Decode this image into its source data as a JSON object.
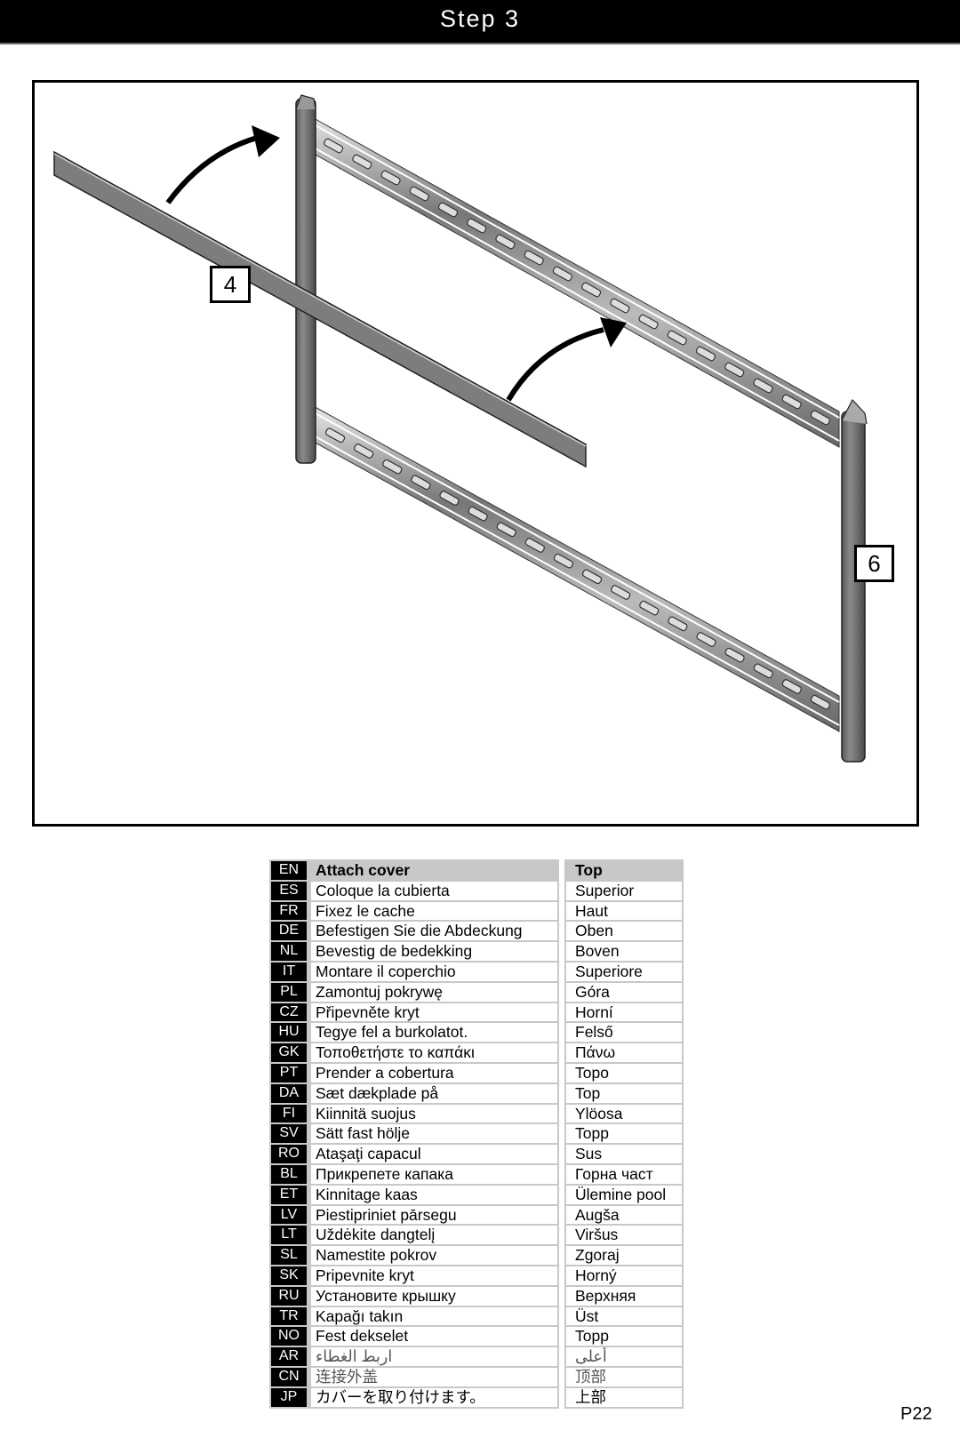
{
  "header": {
    "title": "Step 3"
  },
  "figure": {
    "callouts": [
      {
        "label": "4",
        "part": "cover"
      },
      {
        "label": "6",
        "part": "frame-upright"
      }
    ],
    "arrows": 2
  },
  "table": {
    "rows": [
      {
        "code": "EN",
        "action": "Attach cover",
        "position": "Top"
      },
      {
        "code": "ES",
        "action": "Coloque la cubierta",
        "position": "Superior"
      },
      {
        "code": "FR",
        "action": "Fixez le cache",
        "position": "Haut"
      },
      {
        "code": "DE",
        "action": "Befestigen Sie die Abdeckung",
        "position": "Oben"
      },
      {
        "code": "NL",
        "action": "Bevestig de bedekking",
        "position": "Boven"
      },
      {
        "code": "IT",
        "action": "Montare il coperchio",
        "position": "Superiore"
      },
      {
        "code": "PL",
        "action": "Zamontuj pokrywę",
        "position": "Góra"
      },
      {
        "code": "CZ",
        "action": "Připevněte kryt",
        "position": "Horní"
      },
      {
        "code": "HU",
        "action": "Tegye fel a burkolatot.",
        "position": "Felső"
      },
      {
        "code": "GK",
        "action": "Τοποθετήστε το καπάκι",
        "position": "Πάνω"
      },
      {
        "code": "PT",
        "action": "Prender a cobertura",
        "position": "Topo"
      },
      {
        "code": "DA",
        "action": "Sæt dækplade på",
        "position": "Top"
      },
      {
        "code": "FI",
        "action": "Kiinnitä suojus",
        "position": "Ylöosa"
      },
      {
        "code": "SV",
        "action": "Sätt fast hölje",
        "position": "Topp"
      },
      {
        "code": "RO",
        "action": "Ataşaţi capacul",
        "position": "Sus"
      },
      {
        "code": "BL",
        "action": "Прикрепете капака",
        "position": "Горна част"
      },
      {
        "code": "ET",
        "action": "Kinnitage kaas",
        "position": "Ülemine pool"
      },
      {
        "code": "LV",
        "action": "Piestipriniet pārsegu",
        "position": "Augša"
      },
      {
        "code": "LT",
        "action": "Uždėkite dangtelį",
        "position": "Viršus"
      },
      {
        "code": "SL",
        "action": "Namestite pokrov",
        "position": "Zgoraj"
      },
      {
        "code": "SK",
        "action": "Pripevnite kryt",
        "position": "Horný"
      },
      {
        "code": "RU",
        "action": "Установите крышку",
        "position": "Верхняя"
      },
      {
        "code": "TR",
        "action": "Kapağı takın",
        "position": "Üst"
      },
      {
        "code": "NO",
        "action": "Fest dekselet",
        "position": "Topp"
      },
      {
        "code": "AR",
        "action": "اربط الغطاء",
        "position": "أعلى"
      },
      {
        "code": "CN",
        "action": "连接外盖",
        "position": "顶部"
      },
      {
        "code": "JP",
        "action": "カバーを取り付けます。",
        "position": "上部"
      }
    ]
  },
  "footer": {
    "page": "P22"
  }
}
